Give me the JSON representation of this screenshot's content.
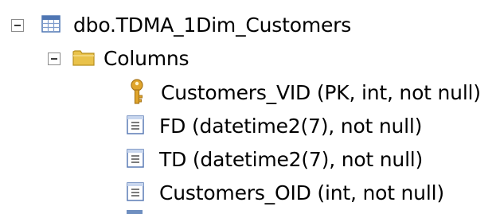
{
  "tree": {
    "table": {
      "label": "dbo.TDMA_1Dim_Customers",
      "icon": "table-icon",
      "expanded": true
    },
    "folder": {
      "label": "Columns",
      "icon": "folder-icon",
      "expanded": true
    },
    "columns": [
      {
        "label": "Customers_VID (PK, int, not null)",
        "icon": "key-icon"
      },
      {
        "label": "FD (datetime2(7), not null)",
        "icon": "column-icon"
      },
      {
        "label": "TD (datetime2(7), not null)",
        "icon": "column-icon"
      },
      {
        "label": "Customers_OID (int, not null)",
        "icon": "column-icon"
      }
    ]
  },
  "colors": {
    "folder": "#e9c24a",
    "key": "#e0a52c",
    "column_icon_border": "#5a7bb5"
  }
}
